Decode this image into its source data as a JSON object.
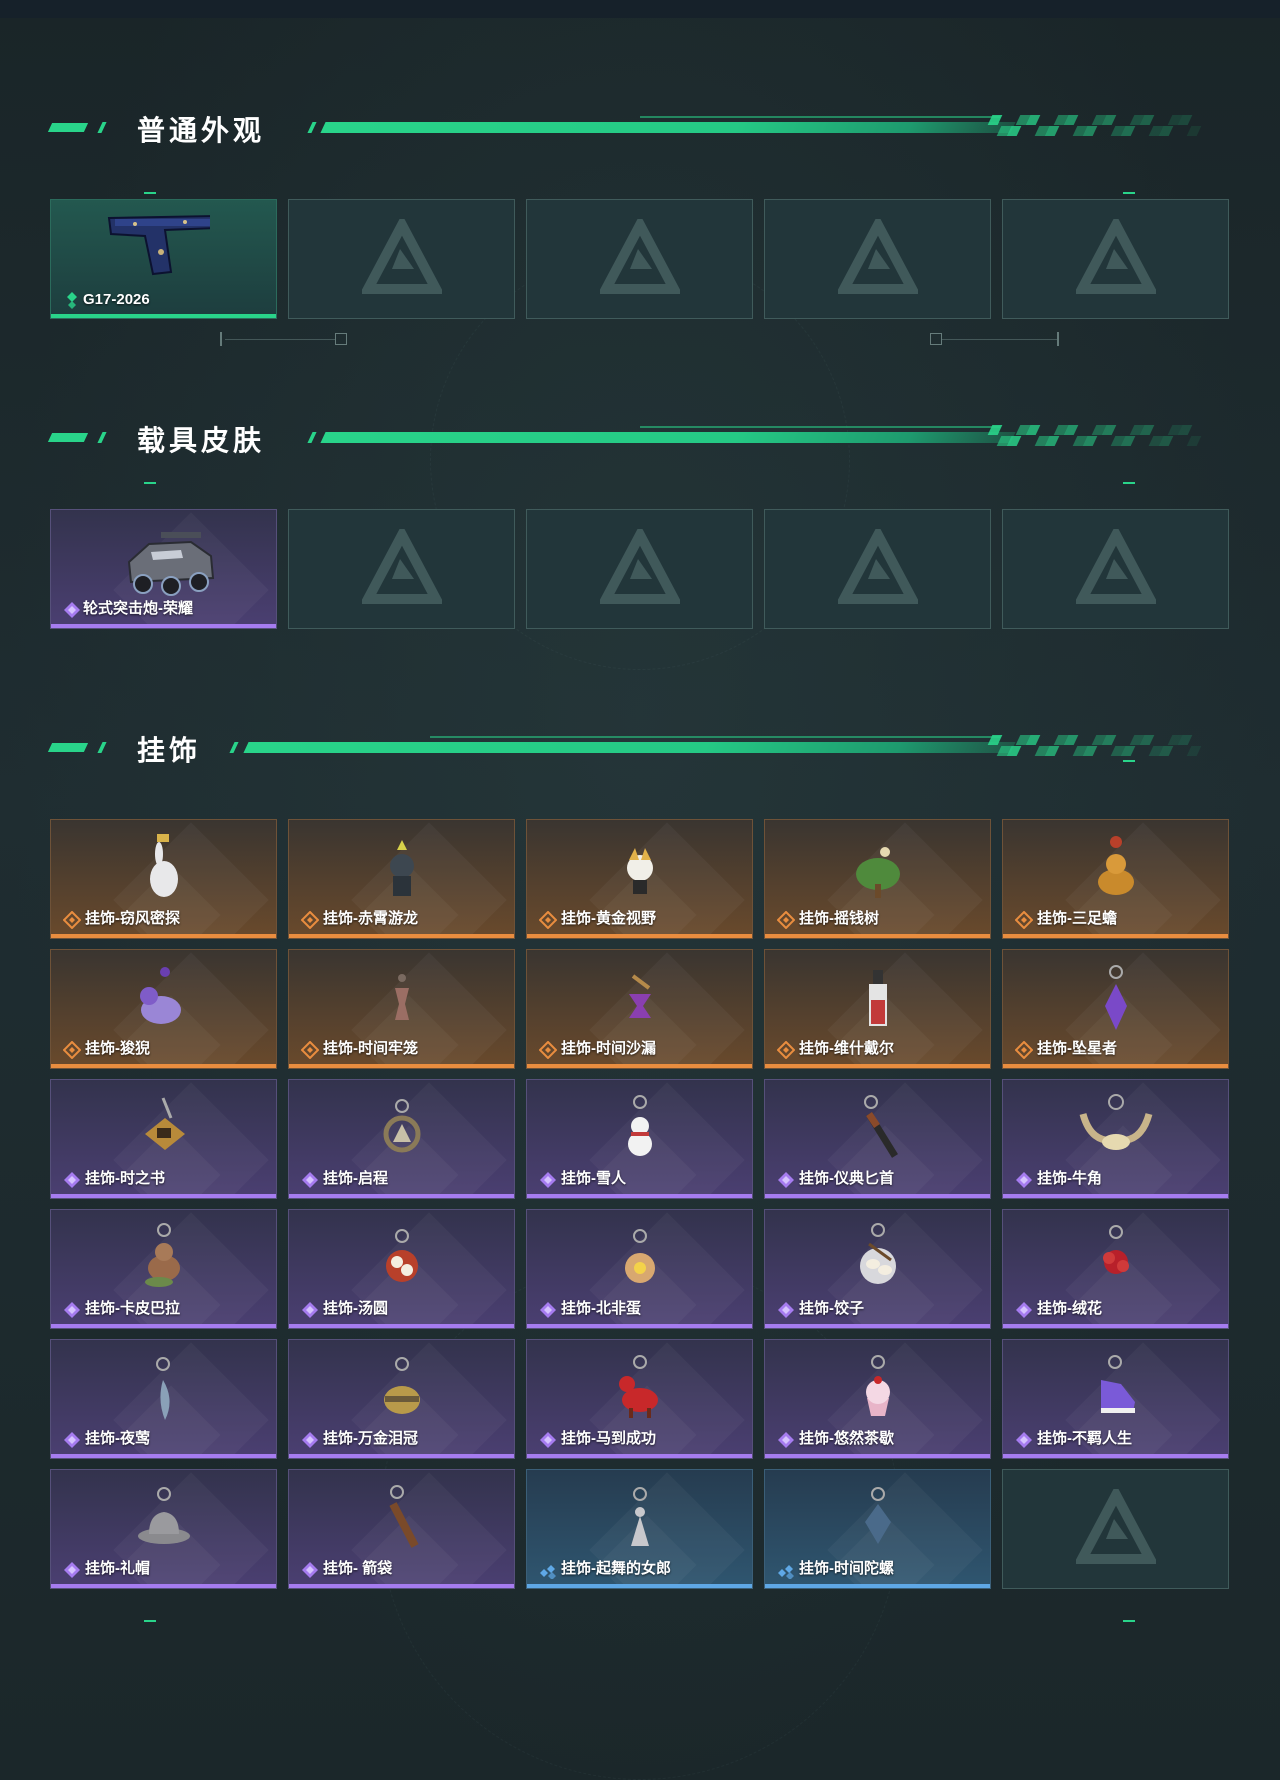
{
  "sections": {
    "weapon": {
      "title": "普通外观",
      "items": [
        {
          "name": "G17-2026",
          "rarity": "green",
          "icon": "pistol-icon"
        }
      ]
    },
    "vehicle": {
      "title": "载具皮肤",
      "items": [
        {
          "name": "轮式突击炮-荣耀",
          "rarity": "purple",
          "icon": "armored-vehicle-icon"
        }
      ]
    },
    "charms": {
      "title": "挂饰",
      "items": [
        {
          "name": "挂饰-窃风密探",
          "rarity": "orange",
          "icon": "white-rabbit-charm-icon"
        },
        {
          "name": "挂饰-赤霄游龙",
          "rarity": "orange",
          "icon": "dragon-figure-charm-icon"
        },
        {
          "name": "挂饰-黄金视野",
          "rarity": "orange",
          "icon": "golden-fox-charm-icon"
        },
        {
          "name": "挂饰-摇钱树",
          "rarity": "orange",
          "icon": "money-tree-charm-icon"
        },
        {
          "name": "挂饰-三足蟾",
          "rarity": "orange",
          "icon": "golden-toad-charm-icon"
        },
        {
          "name": "挂饰-狻猊",
          "rarity": "orange",
          "icon": "purple-lion-charm-icon"
        },
        {
          "name": "挂饰-时间牢笼",
          "rarity": "orange",
          "icon": "hourglass-cage-charm-icon"
        },
        {
          "name": "挂饰-时间沙漏",
          "rarity": "orange",
          "icon": "hourglass-charm-icon"
        },
        {
          "name": "挂饰-维什戴尔",
          "rarity": "orange",
          "icon": "red-tag-charm-icon"
        },
        {
          "name": "挂饰-坠星者",
          "rarity": "orange",
          "icon": "purple-crystal-charm-icon"
        },
        {
          "name": "挂饰-时之书",
          "rarity": "purple",
          "icon": "book-charm-icon"
        },
        {
          "name": "挂饰-启程",
          "rarity": "purple",
          "icon": "medallion-charm-icon"
        },
        {
          "name": "挂饰-雪人",
          "rarity": "purple",
          "icon": "snowman-charm-icon"
        },
        {
          "name": "挂饰-仪典匕首",
          "rarity": "purple",
          "icon": "dagger-charm-icon"
        },
        {
          "name": "挂饰-牛角",
          "rarity": "purple",
          "icon": "horns-charm-icon"
        },
        {
          "name": "挂饰-卡皮巴拉",
          "rarity": "purple",
          "icon": "capybara-charm-icon"
        },
        {
          "name": "挂饰-汤圆",
          "rarity": "purple",
          "icon": "dumpling-bowl-charm-icon"
        },
        {
          "name": "挂饰-北非蛋",
          "rarity": "purple",
          "icon": "egg-dish-charm-icon"
        },
        {
          "name": "挂饰-饺子",
          "rarity": "purple",
          "icon": "dumplings-plate-charm-icon"
        },
        {
          "name": "挂饰-绒花",
          "rarity": "purple",
          "icon": "red-flower-charm-icon"
        },
        {
          "name": "挂饰-夜莺",
          "rarity": "purple",
          "icon": "feather-charm-icon"
        },
        {
          "name": "挂饰-万金泪冠",
          "rarity": "purple",
          "icon": "golden-crown-charm-icon"
        },
        {
          "name": "挂饰-马到成功",
          "rarity": "purple",
          "icon": "red-horse-charm-icon"
        },
        {
          "name": "挂饰-悠然茶歇",
          "rarity": "purple",
          "icon": "cupcake-charm-icon"
        },
        {
          "name": "挂饰-不羁人生",
          "rarity": "purple",
          "icon": "sneaker-charm-icon"
        },
        {
          "name": "挂饰-礼帽",
          "rarity": "purple",
          "icon": "fedora-charm-icon"
        },
        {
          "name": "挂饰- 箭袋",
          "rarity": "purple",
          "icon": "quiver-charm-icon"
        },
        {
          "name": "挂饰-起舞的女郎",
          "rarity": "blue",
          "icon": "dancer-charm-icon"
        },
        {
          "name": "挂饰-时间陀螺",
          "rarity": "blue",
          "icon": "spinning-top-charm-icon"
        }
      ]
    }
  },
  "colors": {
    "accent": "#29d48a",
    "green": "#29d48a",
    "purple": "#a67cf0",
    "orange": "#e98d3f",
    "blue": "#5fa8e6",
    "empty_logo": "triangle-logo-icon"
  }
}
